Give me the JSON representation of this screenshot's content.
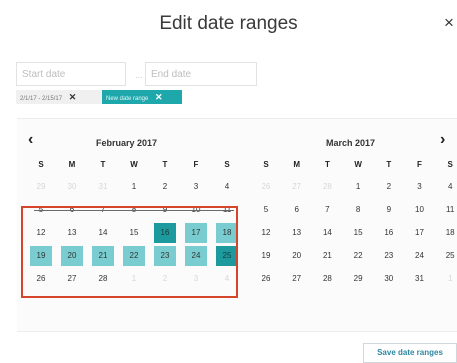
{
  "dialog": {
    "title": "Edit date ranges",
    "close_glyph": "×"
  },
  "inputs": {
    "start_placeholder": "Start date",
    "separator": "...",
    "end_placeholder": "End date"
  },
  "chips": [
    {
      "label": "2/1/17 - 2/15/17",
      "remove_glyph": "✕"
    },
    {
      "label": "New date range",
      "remove_glyph": "✕"
    }
  ],
  "calendar": {
    "prev_glyph": "‹",
    "next_glyph": "›",
    "weekday_labels": [
      "S",
      "M",
      "T",
      "W",
      "T",
      "F",
      "S"
    ],
    "months": [
      {
        "title": "February 2017",
        "weeks": [
          [
            29,
            30,
            31,
            1,
            2,
            3,
            4
          ],
          [
            5,
            6,
            7,
            8,
            9,
            10,
            11
          ],
          [
            12,
            13,
            14,
            15,
            16,
            17,
            18
          ],
          [
            19,
            20,
            21,
            22,
            23,
            24,
            25
          ],
          [
            26,
            27,
            28,
            1,
            2,
            3,
            4
          ]
        ],
        "outside_days": [
          "0-0",
          "0-1",
          "0-2",
          "4-3",
          "4-4",
          "4-5",
          "4-6"
        ],
        "struck_days": [
          "1-0",
          "1-1",
          "1-2",
          "1-3",
          "1-4",
          "1-5",
          "1-6"
        ],
        "range_days": [
          "2-4",
          "2-5",
          "2-6",
          "3-0",
          "3-1",
          "3-2",
          "3-3",
          "3-4",
          "3-5",
          "3-6"
        ],
        "range_endpoints": [
          "2-4",
          "3-6"
        ]
      },
      {
        "title": "March 2017",
        "weeks": [
          [
            26,
            27,
            28,
            1,
            2,
            3,
            4
          ],
          [
            5,
            6,
            7,
            8,
            9,
            10,
            11
          ],
          [
            12,
            13,
            14,
            15,
            16,
            17,
            18
          ],
          [
            19,
            20,
            21,
            22,
            23,
            24,
            25
          ],
          [
            26,
            27,
            28,
            29,
            30,
            31,
            1
          ]
        ],
        "outside_days": [
          "0-0",
          "0-1",
          "0-2",
          "4-6"
        ],
        "struck_days": [],
        "range_days": [],
        "range_endpoints": []
      }
    ]
  },
  "footer": {
    "save_label": "Save date ranges"
  },
  "colors": {
    "accent": "#1fa8ac",
    "range_fill": "#79cdd0",
    "range_endpoint": "#1d9a9e",
    "annotation_box": "#d6442b"
  }
}
